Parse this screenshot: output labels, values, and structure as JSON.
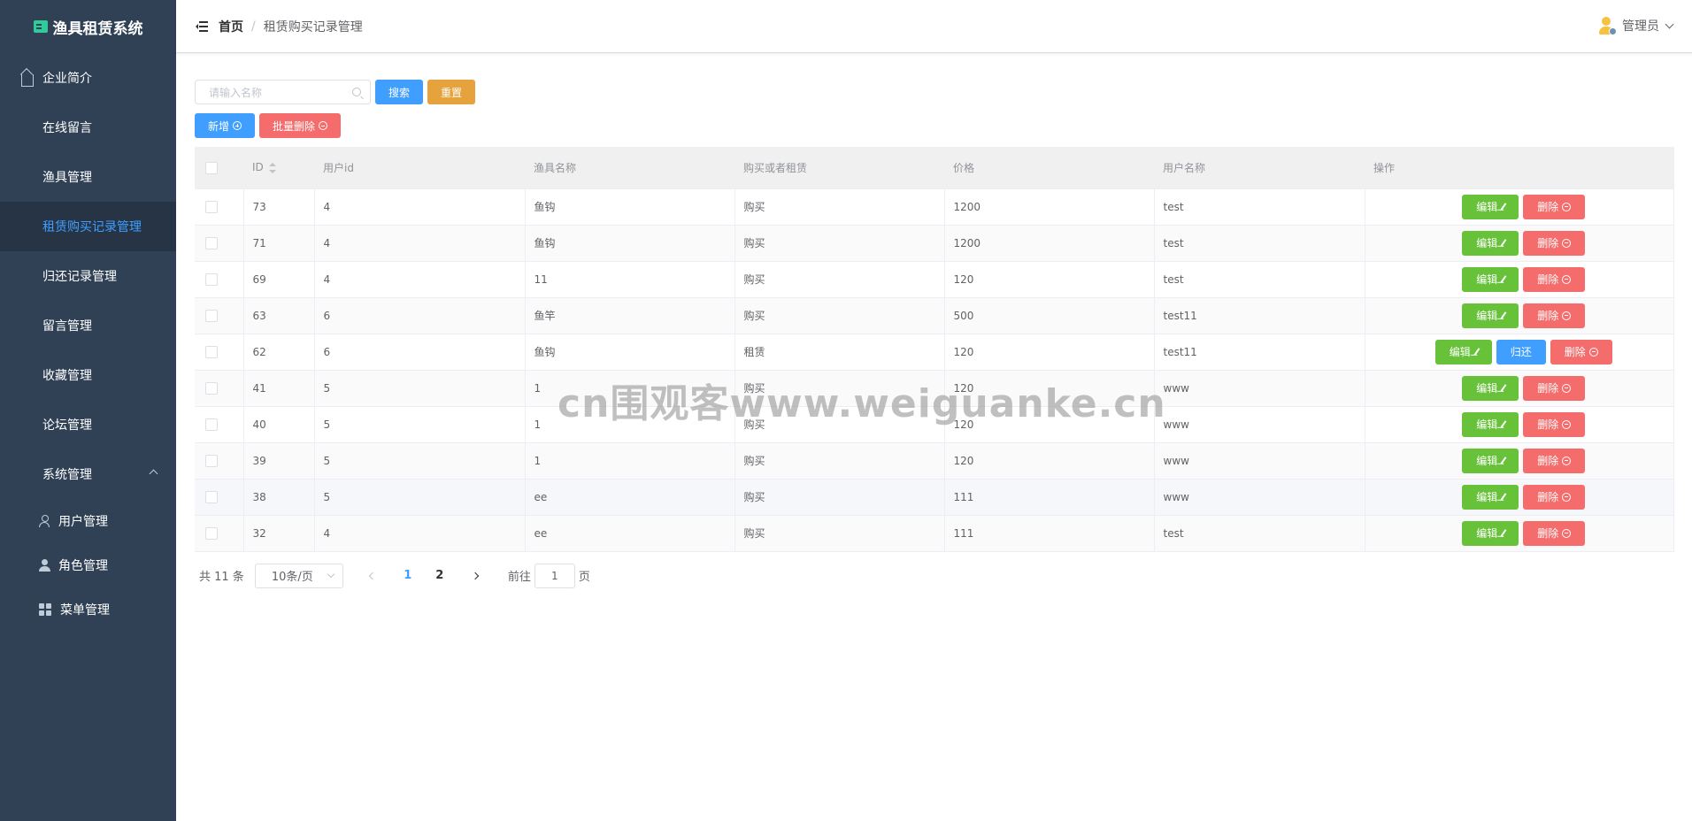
{
  "app": {
    "title": "渔具租赁系统"
  },
  "sidebar": {
    "items": [
      {
        "label": "企业简介",
        "icon": "home-icon"
      },
      {
        "label": "在线留言",
        "icon": "grid-icon"
      },
      {
        "label": "渔具管理",
        "icon": "grid-icon"
      },
      {
        "label": "租赁购买记录管理",
        "icon": "grid-icon",
        "active": true
      },
      {
        "label": "归还记录管理",
        "icon": "grid-icon"
      },
      {
        "label": "留言管理",
        "icon": "grid-icon"
      },
      {
        "label": "收藏管理",
        "icon": "grid-icon"
      },
      {
        "label": "论坛管理",
        "icon": "grid-icon"
      },
      {
        "label": "系统管理",
        "icon": "apps-icon",
        "expanded": true
      }
    ],
    "sub_items": [
      {
        "label": "用户管理",
        "icon": "user-icon"
      },
      {
        "label": "角色管理",
        "icon": "user-filled-icon"
      },
      {
        "label": "菜单管理",
        "icon": "grid-icon"
      }
    ]
  },
  "header": {
    "breadcrumb": {
      "home": "首页",
      "separator": "/",
      "current": "租赁购买记录管理"
    },
    "user": {
      "name": "管理员"
    }
  },
  "toolbar": {
    "search_placeholder": "请输入名称",
    "search_label": "搜索",
    "reset_label": "重置",
    "add_label": "新增",
    "batch_delete_label": "批量删除"
  },
  "table": {
    "columns": [
      "ID",
      "用户id",
      "渔具名称",
      "购买或者租赁",
      "价格",
      "用户名称",
      "操作"
    ],
    "actions": {
      "edit": "编辑",
      "return": "归还",
      "delete": "删除"
    },
    "rows": [
      {
        "id": "73",
        "user_id": "4",
        "gear": "鱼钩",
        "type": "购买",
        "price": "1200",
        "username": "test"
      },
      {
        "id": "71",
        "user_id": "4",
        "gear": "鱼钩",
        "type": "购买",
        "price": "1200",
        "username": "test"
      },
      {
        "id": "69",
        "user_id": "4",
        "gear": "11",
        "type": "购买",
        "price": "120",
        "username": "test"
      },
      {
        "id": "63",
        "user_id": "6",
        "gear": "鱼竿",
        "type": "购买",
        "price": "500",
        "username": "test11"
      },
      {
        "id": "62",
        "user_id": "6",
        "gear": "鱼钩",
        "type": "租赁",
        "price": "120",
        "username": "test11"
      },
      {
        "id": "41",
        "user_id": "5",
        "gear": "1",
        "type": "购买",
        "price": "120",
        "username": "www"
      },
      {
        "id": "40",
        "user_id": "5",
        "gear": "1",
        "type": "购买",
        "price": "120",
        "username": "www"
      },
      {
        "id": "39",
        "user_id": "5",
        "gear": "1",
        "type": "购买",
        "price": "120",
        "username": "www"
      },
      {
        "id": "38",
        "user_id": "5",
        "gear": "ee",
        "type": "购买",
        "price": "111",
        "username": "www"
      },
      {
        "id": "32",
        "user_id": "4",
        "gear": "ee",
        "type": "购买",
        "price": "111",
        "username": "test"
      }
    ]
  },
  "pagination": {
    "total": "共 11 条",
    "page_size": "10条/页",
    "pages": [
      "1",
      "2"
    ],
    "goto_prefix": "前往",
    "goto_value": "1",
    "goto_suffix": "页"
  },
  "watermark": "cn围观客www.weiguanke.cn",
  "colors": {
    "sidebar_bg": "#304156",
    "primary": "#409eff",
    "success": "#67c23a",
    "warning": "#e6a23c",
    "danger": "#f56c6c"
  }
}
